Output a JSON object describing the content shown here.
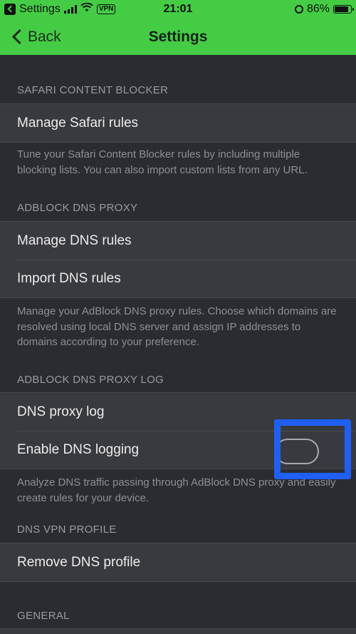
{
  "status_bar": {
    "back_app": "Settings",
    "vpn": "VPN",
    "time": "21:01",
    "battery": "86%",
    "battery_level": 0.86
  },
  "nav": {
    "back_label": "Back",
    "title": "Settings"
  },
  "sections": {
    "safari": {
      "header": "SAFARI CONTENT BLOCKER",
      "rows": [
        "Manage Safari rules"
      ],
      "footer": "Tune your Safari Content Blocker rules by including multiple blocking lists. You can also import custom lists from any URL."
    },
    "dns_proxy": {
      "header": "ADBLOCK DNS PROXY",
      "rows": [
        "Manage DNS rules",
        "Import DNS rules"
      ],
      "footer": "Manage your AdBlock DNS proxy rules. Choose which domains are resolved using local DNS server and assign IP addresses to domains according to your preference."
    },
    "dns_log": {
      "header": "ADBLOCK DNS PROXY LOG",
      "rows": [
        "DNS proxy log",
        "Enable DNS logging"
      ],
      "toggle_on": false,
      "footer": "Analyze DNS traffic passing through AdBlock DNS proxy and easily create rules for your device."
    },
    "vpn_profile": {
      "header": "DNS VPN PROFILE",
      "rows": [
        "Remove DNS profile"
      ]
    },
    "general": {
      "header": "GENERAL"
    }
  },
  "colors": {
    "accent_green": "#45cc45",
    "background": "#2b2c31",
    "row_background": "#393a3f",
    "highlight_blue": "#1f5ff2"
  }
}
